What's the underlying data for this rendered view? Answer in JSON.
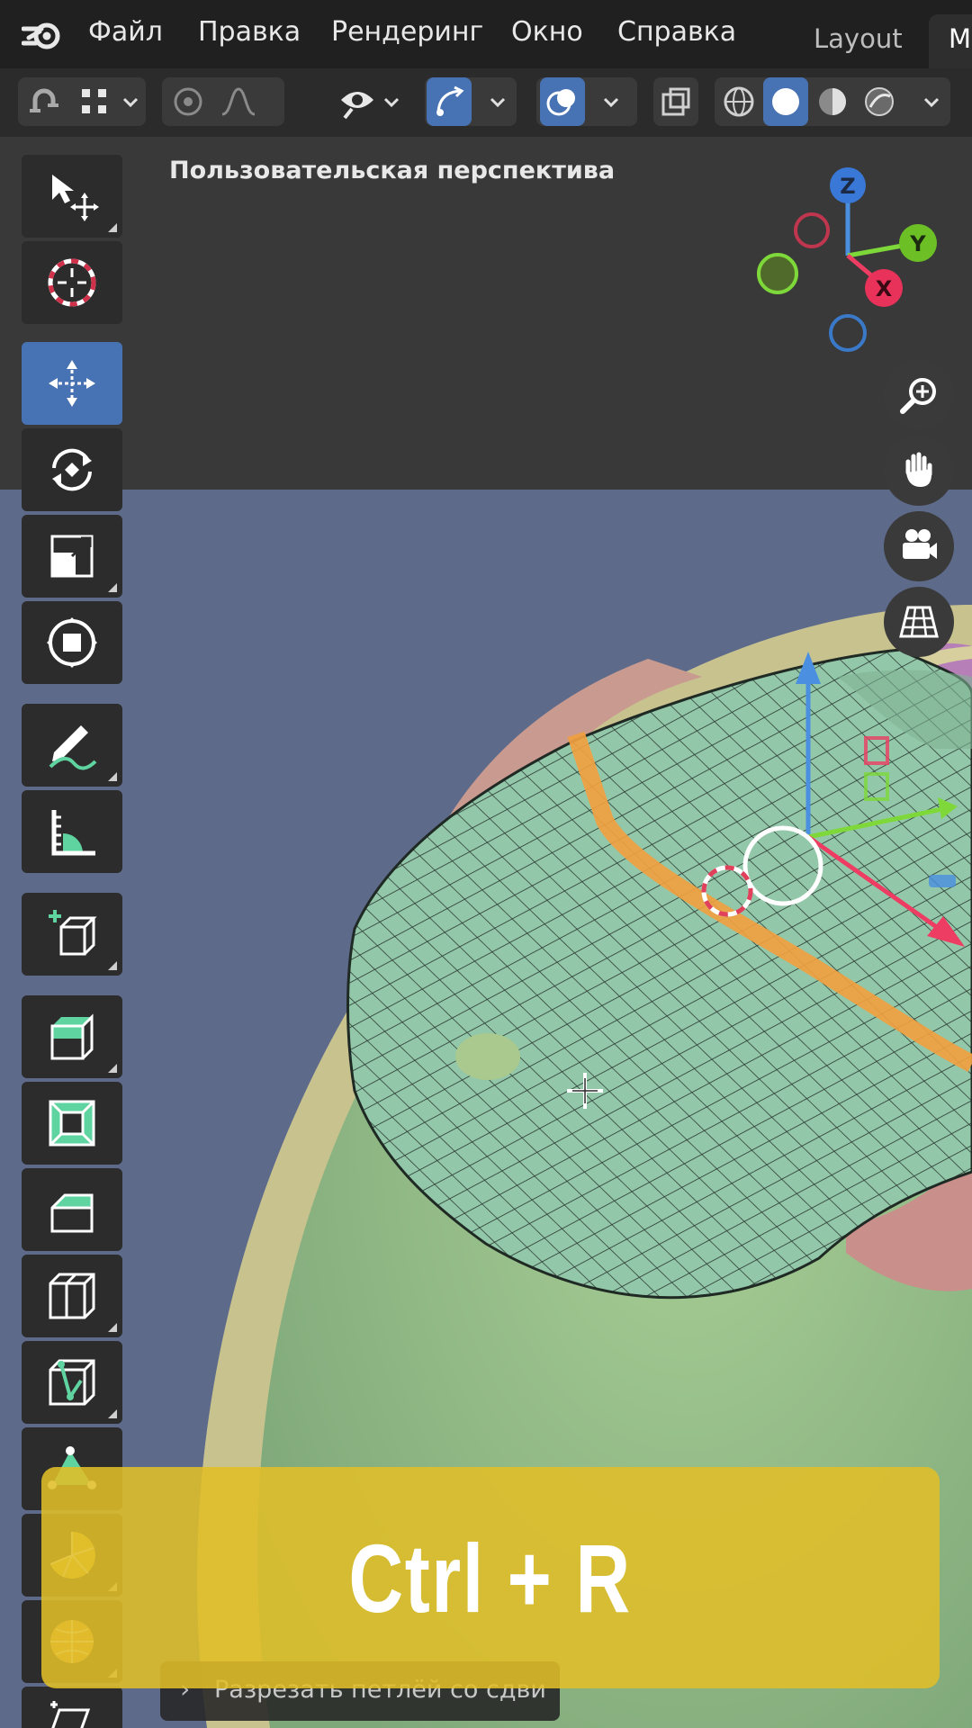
{
  "menubar": {
    "items": [
      "Файл",
      "Правка",
      "Рендеринг",
      "Окно",
      "Справка"
    ],
    "workspace_tabs": [
      {
        "label": "Layout",
        "active": false
      },
      {
        "label": "M",
        "active": true
      }
    ]
  },
  "toolbar": {
    "icons": [
      "snap-icon",
      "snap-grid-icon",
      "proportional-edit-icon",
      "falloff-curve-icon",
      "visibility-icon",
      "gizmo-icon",
      "overlay-icon",
      "xray-icon",
      "wireframe-shading-icon",
      "solid-shading-icon",
      "material-shading-icon",
      "rendered-shading-icon"
    ]
  },
  "viewport": {
    "label": "Пользовательская перспектива",
    "axes": {
      "z": "Z",
      "y": "Y",
      "x": "X"
    }
  },
  "tools": [
    "select-move-icon",
    "cursor-icon",
    "move-icon",
    "rotate-icon",
    "scale-icon",
    "transform-icon",
    "annotate-icon",
    "measure-icon",
    "add-cube-icon",
    "extrude-icon",
    "inset-icon",
    "bevel-icon",
    "loop-cut-icon",
    "knife-icon",
    "poly-build-icon",
    "spin-icon",
    "smooth-icon",
    "shear-icon"
  ],
  "nav_buttons": [
    "zoom-icon",
    "pan-hand-icon",
    "camera-icon",
    "grid-projection-icon"
  ],
  "banner": {
    "shortcut": "Ctrl + R"
  },
  "operator_panel": {
    "arrow": "›",
    "title": "Разрезать петлёй со сдви"
  },
  "colors": {
    "accent": "#4772b3",
    "banner": "#e0be28",
    "mesh_green": "#8fc4a4",
    "mesh_pink": "#c98f8a",
    "mesh_purple": "#b77fb8",
    "edge_loop": "#f0a040"
  }
}
